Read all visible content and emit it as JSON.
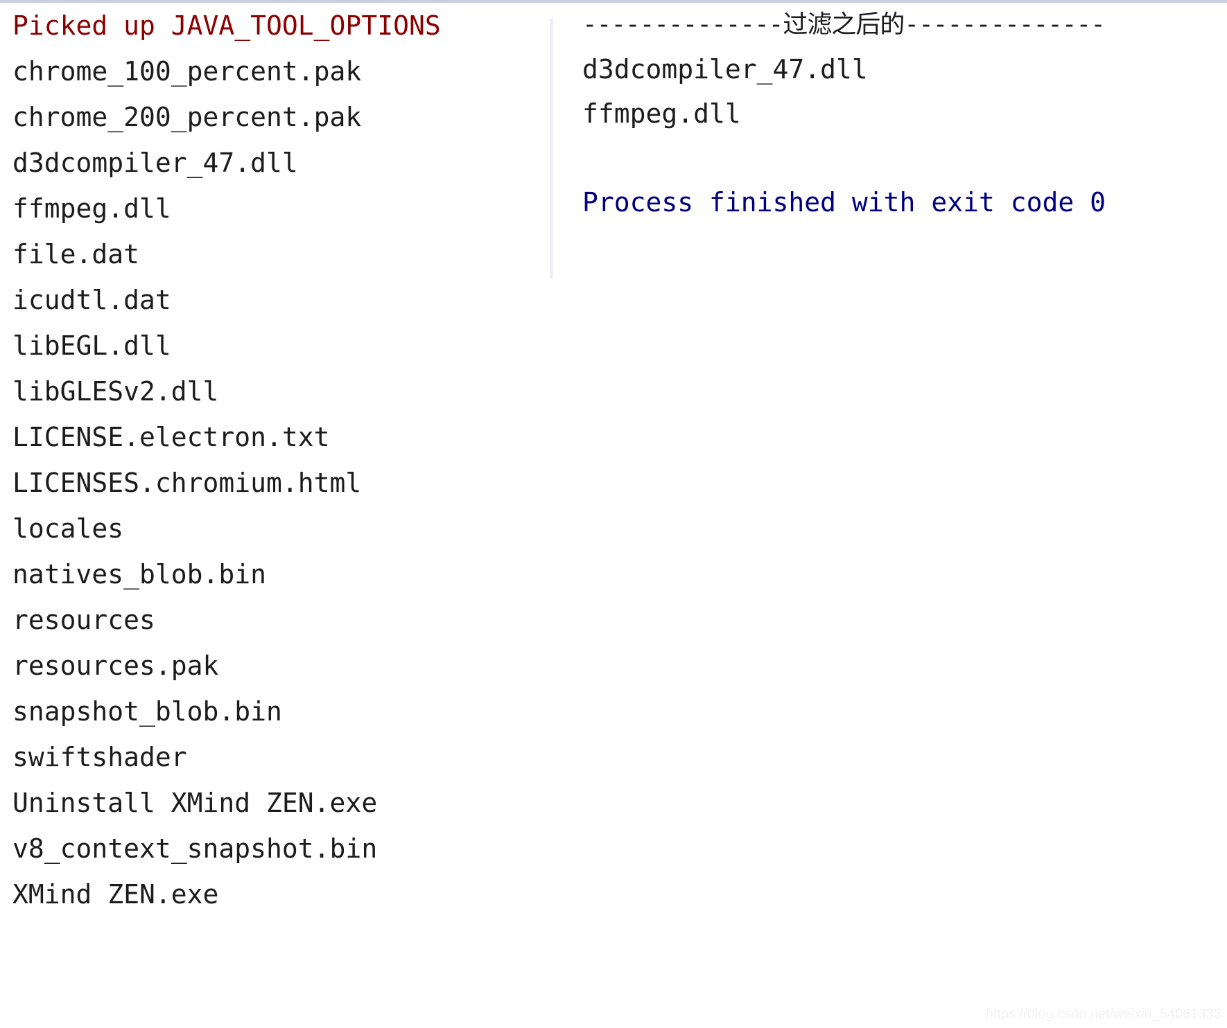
{
  "console": {
    "theme": {
      "background": "#ffffff",
      "default_text": "#1c1c1c",
      "warn_text": "#8b0000",
      "info_text": "#000080",
      "divider": "#eceef1",
      "top_bar": "#c9cedb",
      "watermark_text": "#f2f2f2"
    },
    "left_column": {
      "lines": [
        {
          "text": "Picked up JAVA_TOOL_OPTIONS",
          "level": "warn"
        },
        {
          "text": "chrome_100_percent.pak",
          "level": "default"
        },
        {
          "text": "chrome_200_percent.pak",
          "level": "default"
        },
        {
          "text": "d3dcompiler_47.dll",
          "level": "default"
        },
        {
          "text": "ffmpeg.dll",
          "level": "default"
        },
        {
          "text": "file.dat",
          "level": "default"
        },
        {
          "text": "icudtl.dat",
          "level": "default"
        },
        {
          "text": "libEGL.dll",
          "level": "default"
        },
        {
          "text": "libGLESv2.dll",
          "level": "default"
        },
        {
          "text": "LICENSE.electron.txt",
          "level": "default"
        },
        {
          "text": "LICENSES.chromium.html",
          "level": "default"
        },
        {
          "text": "locales",
          "level": "default"
        },
        {
          "text": "natives_blob.bin",
          "level": "default"
        },
        {
          "text": "resources",
          "level": "default"
        },
        {
          "text": "resources.pak",
          "level": "default"
        },
        {
          "text": "snapshot_blob.bin",
          "level": "default"
        },
        {
          "text": "swiftshader",
          "level": "default"
        },
        {
          "text": "Uninstall XMind ZEN.exe",
          "level": "default"
        },
        {
          "text": "v8_context_snapshot.bin",
          "level": "default"
        },
        {
          "text": "XMind ZEN.exe",
          "level": "default"
        }
      ]
    },
    "right_column": {
      "lines": [
        {
          "text": "--------------过滤之后的--------------",
          "level": "default",
          "kind": "separator"
        },
        {
          "text": "d3dcompiler_47.dll",
          "level": "default",
          "kind": "text"
        },
        {
          "text": "ffmpeg.dll",
          "level": "default",
          "kind": "text"
        },
        {
          "text": " ",
          "level": "default",
          "kind": "blank"
        },
        {
          "text": "Process finished with exit code 0",
          "level": "info",
          "kind": "text"
        }
      ]
    },
    "watermark": "https://blog.csdn.net/weixin_54061333"
  }
}
